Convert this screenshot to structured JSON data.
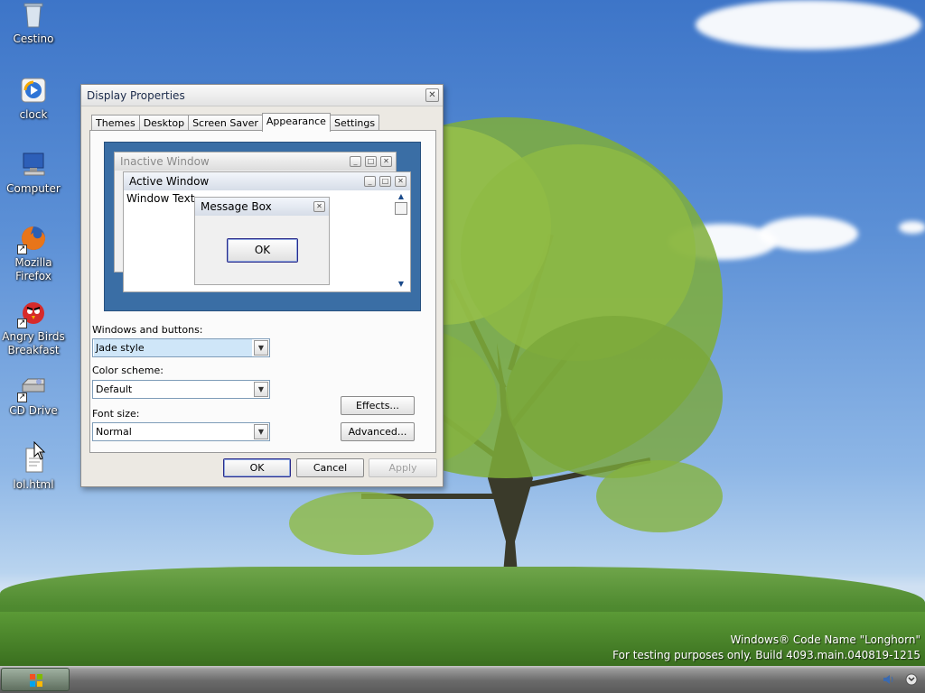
{
  "desktop_icons": [
    {
      "label": "Cestino",
      "icon": "recycle-bin-icon"
    },
    {
      "label": "clock",
      "icon": "media-player-icon"
    },
    {
      "label": "Computer",
      "icon": "computer-icon"
    },
    {
      "label": "Mozilla Firefox",
      "icon": "firefox-icon"
    },
    {
      "label": "Angry Birds Breakfast",
      "icon": "angry-birds-icon"
    },
    {
      "label": "CD Drive",
      "icon": "cd-drive-icon"
    },
    {
      "label": "lol.html",
      "icon": "html-file-icon"
    }
  ],
  "dialog": {
    "title": "Display Properties",
    "close": "✕",
    "tabs": [
      "Themes",
      "Desktop",
      "Screen Saver",
      "Appearance",
      "Settings"
    ],
    "active_tab": "Appearance",
    "preview": {
      "inactive_title": "Inactive Window",
      "active_title": "Active Window",
      "window_text": "Window Text",
      "msgbox_title": "Message Box",
      "msgbox_ok": "OK"
    },
    "windows_buttons_label": "Windows and buttons:",
    "windows_buttons_value": "Jade style",
    "color_scheme_label": "Color scheme:",
    "color_scheme_value": "Default",
    "font_size_label": "Font size:",
    "font_size_value": "Normal",
    "effects_btn": "Effects...",
    "advanced_btn": "Advanced...",
    "ok_btn": "OK",
    "cancel_btn": "Cancel",
    "apply_btn": "Apply"
  },
  "watermark": {
    "line1": "Windows® Code Name \"Longhorn\"",
    "line2": "For testing purposes only. Build 4093.main.040819-1215"
  },
  "colors": {
    "accent": "#3a6ea5",
    "selection": "#cfe6f8"
  }
}
